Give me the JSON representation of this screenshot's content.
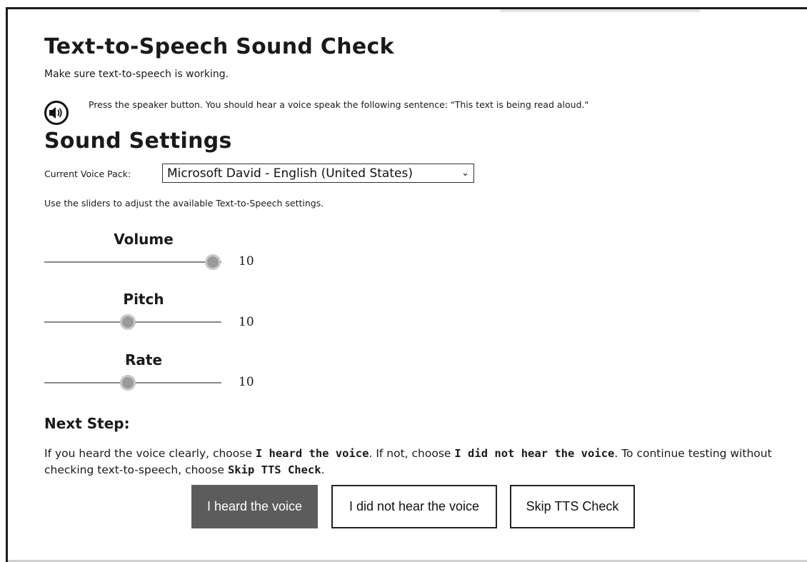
{
  "page": {
    "title": "Text-to-Speech Sound Check",
    "subtitle": "Make sure text-to-speech is working."
  },
  "speaker": {
    "icon": "speaker-icon",
    "instruction": "Press the speaker button. You should hear a voice speak the following sentence: \"This text is being read aloud.\""
  },
  "settings": {
    "title": "Sound Settings",
    "voice_label": "Current Voice Pack:",
    "voice_value": "Microsoft David - English (United States)",
    "sliders_hint": "Use the sliders to adjust the available Text-to-Speech settings.",
    "sliders": [
      {
        "label": "Volume",
        "value": "10",
        "fraction": 0.95
      },
      {
        "label": "Pitch",
        "value": "10",
        "fraction": 0.47
      },
      {
        "label": "Rate",
        "value": "10",
        "fraction": 0.47
      }
    ]
  },
  "next_step": {
    "heading": "Next Step:",
    "text_1": "If you heard the voice clearly, choose ",
    "bold_1": "I heard the voice",
    "text_2": ". If not, choose ",
    "bold_2": "I did not hear the voice",
    "text_3": ". To continue testing without checking text-to-speech, choose ",
    "bold_3": "Skip TTS Check",
    "text_4": "."
  },
  "buttons": {
    "heard": "I heard the voice",
    "not_heard": "I did not hear the voice",
    "skip": "Skip TTS Check"
  },
  "colors": {
    "primary_button": "#5c5c5c",
    "text": "#1a1a1a"
  }
}
